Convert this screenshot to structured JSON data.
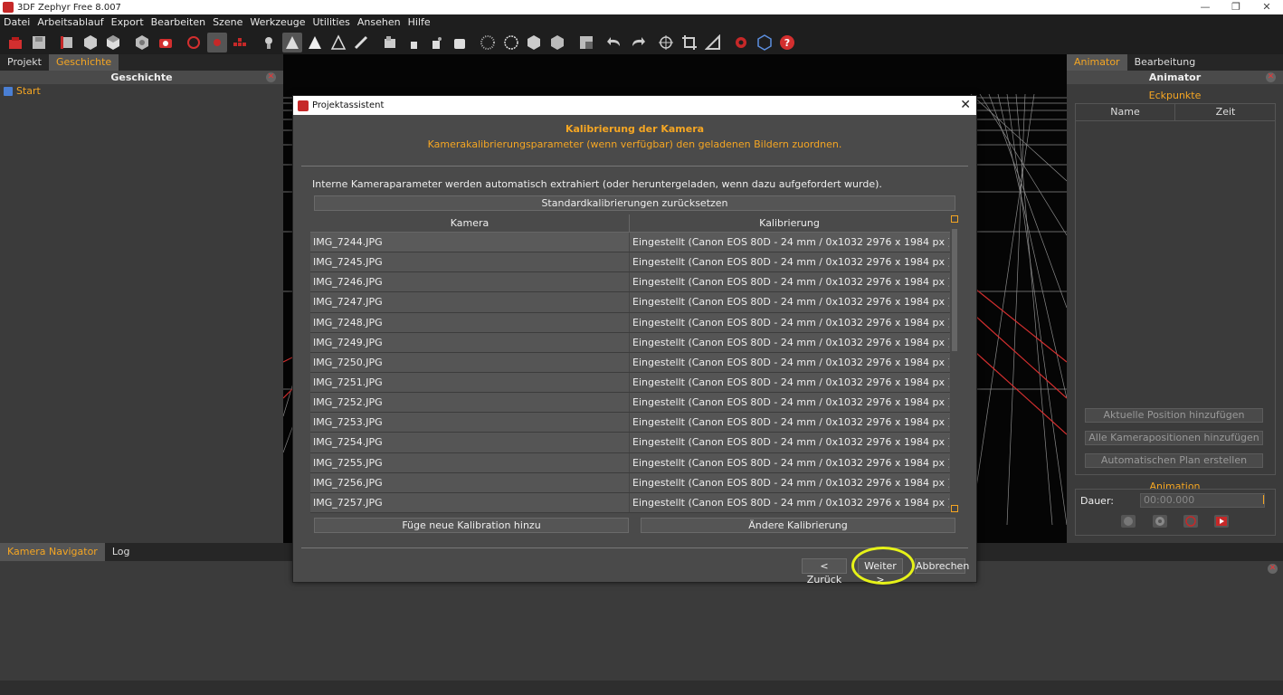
{
  "window": {
    "title": "3DF Zephyr Free 8.007",
    "controls": [
      "—",
      "❐",
      "✕"
    ]
  },
  "menu": [
    "Datei",
    "Arbeitsablauf",
    "Export",
    "Bearbeiten",
    "Szene",
    "Werkzeuge",
    "Utilities",
    "Ansehen",
    "Hilfe"
  ],
  "toolbar": {
    "icons": [
      "new-project-icon",
      "save-icon",
      "sparse-cloud-icon",
      "dense-cloud-icon",
      "mesh-icon",
      "textured-mesh-icon",
      "camera-icon",
      "rotate-icon",
      "record-icon",
      "ortho-icon",
      "light-icon",
      "points-icon",
      "wireframe-icon",
      "solid-icon",
      "brush-icon",
      "select-icon",
      "pointer-icon",
      "lasso-icon",
      "erase-icon",
      "grid-icon",
      "sphere-icon",
      "cube-icon",
      "cube-alt-icon",
      "box-select-icon",
      "undo-icon",
      "redo-icon",
      "move-icon",
      "crop-icon",
      "ruler-icon",
      "settings-icon",
      "3d-view-icon",
      "help-icon"
    ]
  },
  "left_panel": {
    "tabs": [
      "Projekt",
      "Geschichte"
    ],
    "active_tab": "Geschichte",
    "title": "Geschichte",
    "tree_items": [
      "Start"
    ]
  },
  "right_panel": {
    "tabs": [
      "Animator",
      "Bearbeitung"
    ],
    "active_tab": "Animator",
    "title": "Animator",
    "keypoints_label": "Eckpunkte",
    "col_name": "Name",
    "col_time": "Zeit",
    "buttons": [
      "Aktuelle Position hinzufügen",
      "Alle Kamerapositionen hinzufügen",
      "Automatischen Plan erstellen"
    ],
    "animation_label": "Animation",
    "duration_label": "Dauer:",
    "duration_value": "00:00.000"
  },
  "bottom_panel": {
    "tabs": [
      "Kamera Navigator",
      "Log"
    ],
    "active_tab": "Kamera Navigator"
  },
  "dialog": {
    "title": "Projektassistent",
    "heading": "Kalibrierung der Kamera",
    "subheading": "Kamerakalibrierungsparameter (wenn verfügbar) den geladenen Bildern zuordnen.",
    "info": "Interne Kameraparameter werden automatisch extrahiert (oder heruntergeladen, wenn dazu aufgefordert wurde).",
    "reset_button": "Standardkalibrierungen zurücksetzen",
    "table": {
      "headers": [
        "Kamera",
        "Kalibrierung"
      ],
      "rows": [
        [
          "IMG_7244.JPG",
          "Eingestellt (Canon EOS 80D - 24 mm / 0x1032 2976 x 1984 px )"
        ],
        [
          "IMG_7245.JPG",
          "Eingestellt (Canon EOS 80D - 24 mm / 0x1032 2976 x 1984 px )"
        ],
        [
          "IMG_7246.JPG",
          "Eingestellt (Canon EOS 80D - 24 mm / 0x1032 2976 x 1984 px )"
        ],
        [
          "IMG_7247.JPG",
          "Eingestellt (Canon EOS 80D - 24 mm / 0x1032 2976 x 1984 px )"
        ],
        [
          "IMG_7248.JPG",
          "Eingestellt (Canon EOS 80D - 24 mm / 0x1032 2976 x 1984 px )"
        ],
        [
          "IMG_7249.JPG",
          "Eingestellt (Canon EOS 80D - 24 mm / 0x1032 2976 x 1984 px )"
        ],
        [
          "IMG_7250.JPG",
          "Eingestellt (Canon EOS 80D - 24 mm / 0x1032 2976 x 1984 px )"
        ],
        [
          "IMG_7251.JPG",
          "Eingestellt (Canon EOS 80D - 24 mm / 0x1032 2976 x 1984 px )"
        ],
        [
          "IMG_7252.JPG",
          "Eingestellt (Canon EOS 80D - 24 mm / 0x1032 2976 x 1984 px )"
        ],
        [
          "IMG_7253.JPG",
          "Eingestellt (Canon EOS 80D - 24 mm / 0x1032 2976 x 1984 px )"
        ],
        [
          "IMG_7254.JPG",
          "Eingestellt (Canon EOS 80D - 24 mm / 0x1032 2976 x 1984 px )"
        ],
        [
          "IMG_7255.JPG",
          "Eingestellt (Canon EOS 80D - 24 mm / 0x1032 2976 x 1984 px )"
        ],
        [
          "IMG_7256.JPG",
          "Eingestellt (Canon EOS 80D - 24 mm / 0x1032 2976 x 1984 px )"
        ],
        [
          "IMG_7257.JPG",
          "Eingestellt (Canon EOS 80D - 24 mm / 0x1032 2976 x 1984 px )"
        ]
      ]
    },
    "add_calibration_button": "Füge neue Kalibration hinzu",
    "change_calibration_button": "Ändere Kalibrierung",
    "back_button": "< Zurück",
    "next_button": "Weiter >",
    "cancel_button": "Abbrechen"
  },
  "colors": {
    "accent": "#f5a623",
    "highlight": "#e6f218",
    "brand": "#c62828"
  }
}
